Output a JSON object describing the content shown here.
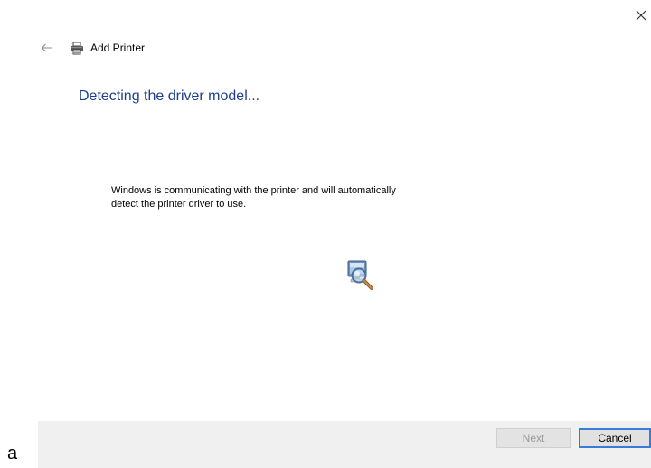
{
  "window": {
    "close_glyph": "×",
    "icons": {
      "close": "close-icon",
      "back": "back-arrow-icon",
      "printer": "printer-icon",
      "detect": "magnifier-computer-icon"
    }
  },
  "header": {
    "title": "Add Printer"
  },
  "main": {
    "heading": "Detecting the driver model...",
    "description": "Windows is communicating with the printer and will automatically detect the printer driver to use."
  },
  "footer": {
    "next_label": "Next",
    "cancel_label": "Cancel"
  },
  "stray_text": "a",
  "colors": {
    "heading": "#1e3f8c",
    "footer_bg": "#f0f0f0",
    "focus_border": "#3a7ad8",
    "disabled_text": "#9a9a9a"
  }
}
